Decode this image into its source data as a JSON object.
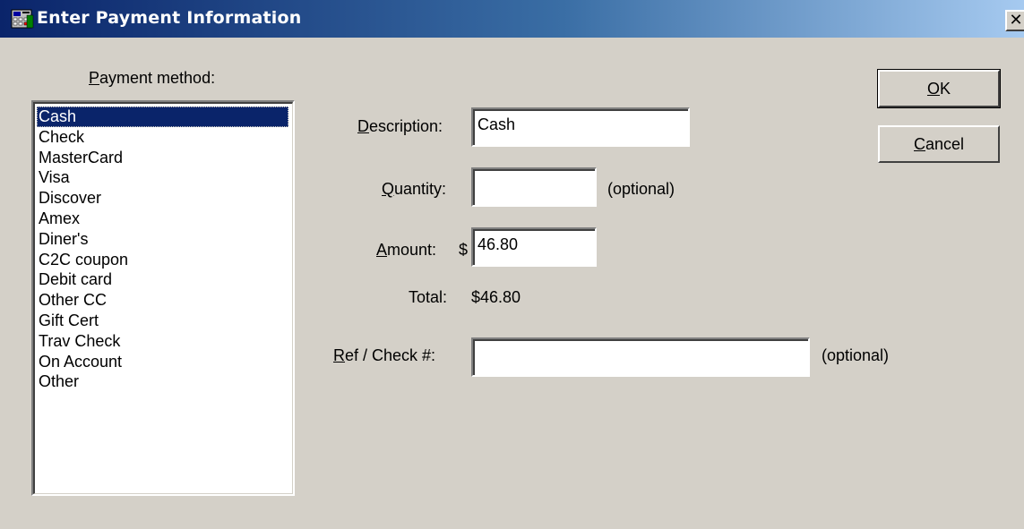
{
  "window": {
    "title": "Enter Payment Information",
    "close_glyph": "✕",
    "icon": "register-app-icon"
  },
  "payment_method": {
    "label": "Payment method:",
    "items": [
      "Cash",
      "Check",
      "MasterCard",
      "Visa",
      "Discover",
      "Amex",
      "Diner's",
      "C2C coupon",
      "Debit card",
      "Other CC",
      "Gift Cert",
      "Trav Check",
      "On Account",
      "Other"
    ],
    "selected": "Cash"
  },
  "description": {
    "label": "Description:",
    "value": "Cash"
  },
  "quantity": {
    "label": "Quantity:",
    "value": "",
    "hint": "(optional)"
  },
  "amount": {
    "label": "Amount:",
    "currency": "$",
    "value": "46.80"
  },
  "total": {
    "label": "Total:",
    "value": "$46.80"
  },
  "ref": {
    "label": "Ref / Check #:",
    "value": "",
    "hint": "(optional)"
  },
  "buttons": {
    "ok": "OK",
    "cancel": "Cancel"
  },
  "colors": {
    "titlebar_start": "#0a246a",
    "titlebar_end": "#a6caf0",
    "face": "#d4d0c8",
    "selection": "#0a246a"
  }
}
